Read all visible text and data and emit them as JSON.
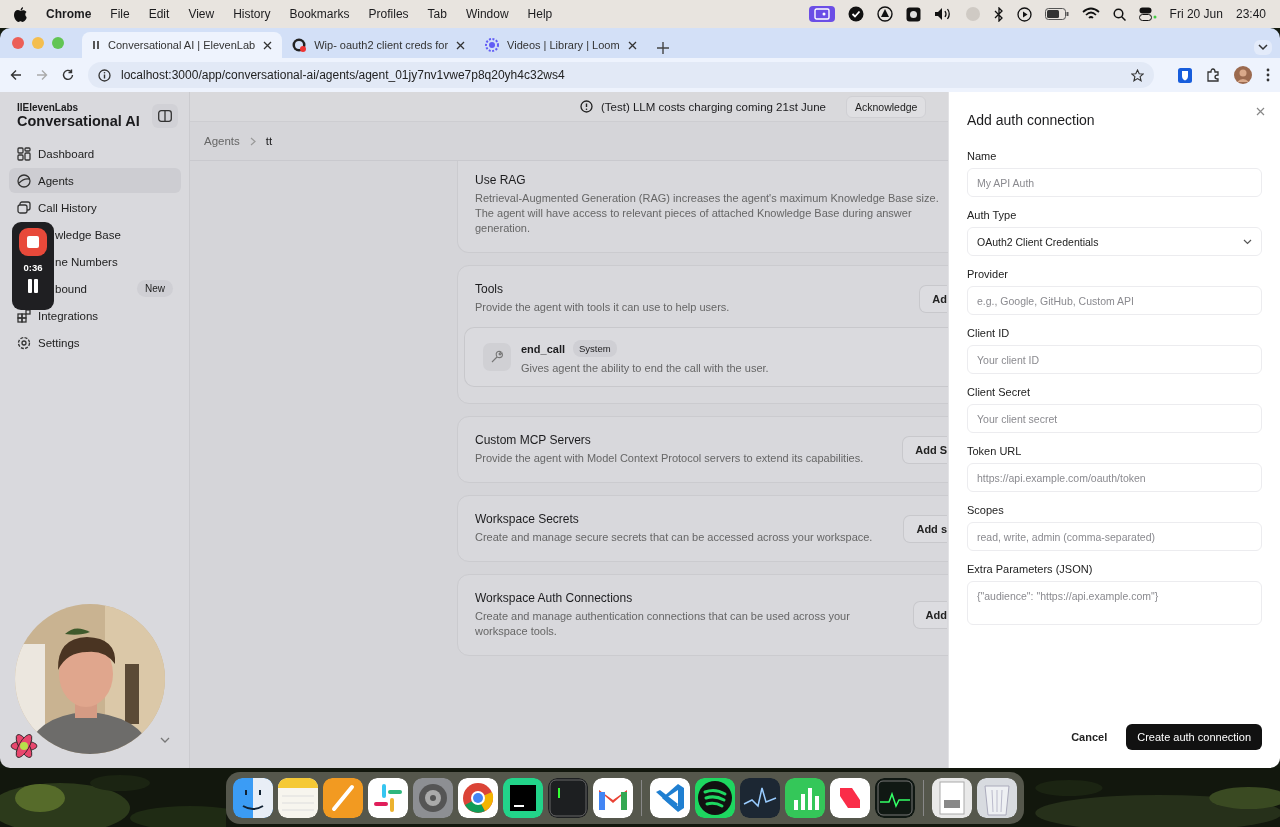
{
  "menu_bar": {
    "app": "Chrome",
    "menus": [
      "File",
      "Edit",
      "View",
      "History",
      "Bookmarks",
      "Profiles",
      "Tab",
      "Window",
      "Help"
    ],
    "date": "Fri 20 Jun",
    "time": "23:40"
  },
  "browser": {
    "tabs": [
      {
        "title": "Conversational AI | ElevenLab",
        "selected": true
      },
      {
        "title": "Wip- oauth2 client creds for",
        "selected": false
      },
      {
        "title": "Videos | Library | Loom",
        "selected": false
      }
    ],
    "url": "localhost:3000/app/conversational-ai/agents/agent_01jy7nv1vwe7p8q20yh4c32ws4"
  },
  "sidebar": {
    "brand": "IIElevenLabs",
    "title": "Conversational AI",
    "items": [
      {
        "label": "Dashboard",
        "selected": false,
        "kind": "item"
      },
      {
        "label": "Agents",
        "selected": true,
        "kind": "item"
      },
      {
        "label": "Call History",
        "selected": false,
        "kind": "item"
      },
      {
        "label": "wledge Base",
        "selected": false,
        "kind": "covered"
      },
      {
        "label": "ne Numbers",
        "selected": false,
        "kind": "covered"
      },
      {
        "label": "bound",
        "selected": false,
        "kind": "covered",
        "badge": "New"
      },
      {
        "label": "Integrations",
        "selected": false,
        "kind": "item"
      },
      {
        "label": "Settings",
        "selected": false,
        "kind": "item"
      }
    ]
  },
  "recording": {
    "time": "0:36"
  },
  "banner": {
    "message": "(Test) LLM costs charging coming 21st June",
    "button": "Acknowledge"
  },
  "breadcrumb": [
    "Agents",
    "tt"
  ],
  "sections": [
    {
      "title": "Use RAG",
      "description": "Retrieval-Augmented Generation (RAG) increases the agent's maximum Knowledge Base size. The agent will have access to relevant pieces of attached Knowledge Base during answer generation."
    },
    {
      "title": "Tools",
      "description": "Provide the agent with tools it can use to help users.",
      "button": "Ad",
      "tools": [
        {
          "name": "end_call",
          "badge": "System",
          "description": "Gives agent the ability to end the call with the user."
        }
      ]
    },
    {
      "title": "Custom MCP Servers",
      "description": "Provide the agent with Model Context Protocol servers to extend its capabilities.",
      "button": "Add S"
    },
    {
      "title": "Workspace Secrets",
      "description": "Create and manage secure secrets that can be accessed across your workspace.",
      "button": "Add s"
    },
    {
      "title": "Workspace Auth Connections",
      "description": "Create and manage authentication connections that can be used across your workspace tools.",
      "button": "Add"
    }
  ],
  "panel": {
    "title": "Add auth connection",
    "fields": [
      {
        "label": "Name",
        "kind": "text",
        "placeholder": "My API Auth"
      },
      {
        "label": "Auth Type",
        "kind": "select",
        "value": "OAuth2 Client Credentials"
      },
      {
        "label": "Provider",
        "kind": "text",
        "placeholder": "e.g., Google, GitHub, Custom API"
      },
      {
        "label": "Client ID",
        "kind": "text",
        "placeholder": "Your client ID"
      },
      {
        "label": "Client Secret",
        "kind": "text",
        "placeholder": "Your client secret"
      },
      {
        "label": "Token URL",
        "kind": "text",
        "placeholder": "https://api.example.com/oauth/token"
      },
      {
        "label": "Scopes",
        "kind": "text",
        "placeholder": "read, write, admin (comma-separated)"
      },
      {
        "label": "Extra Parameters (JSON)",
        "kind": "textarea",
        "placeholder": "{\"audience\": \"https://api.example.com\"}"
      }
    ],
    "buttons": [
      {
        "label": "Cancel",
        "kind": "secondary"
      },
      {
        "label": "Create auth connection",
        "kind": "primary"
      }
    ]
  }
}
